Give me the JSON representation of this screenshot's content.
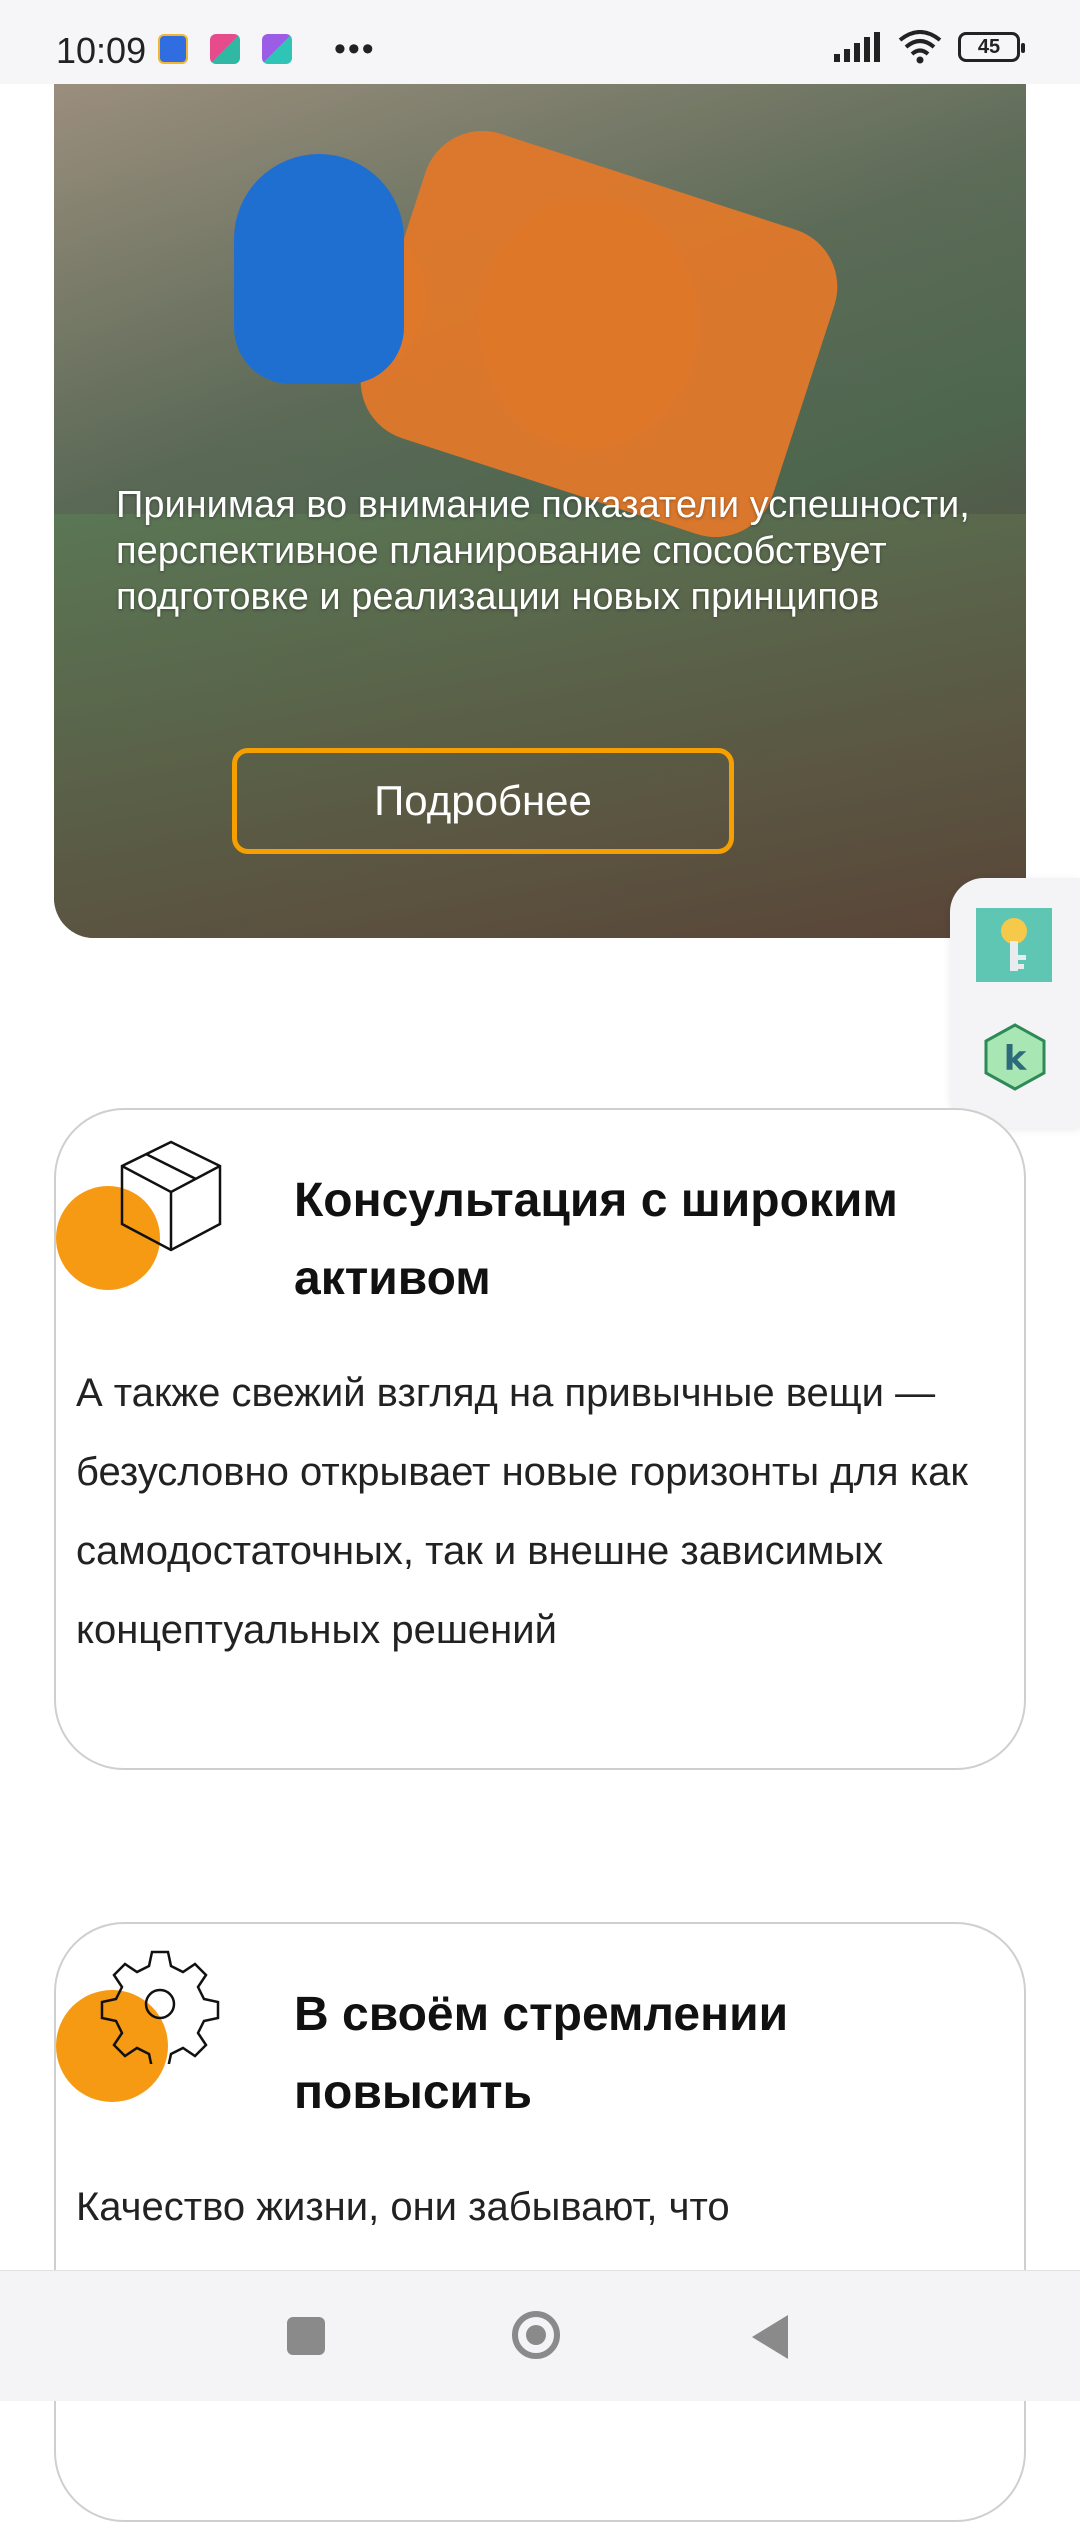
{
  "status_bar": {
    "time": "10:09",
    "battery": "45",
    "icons": [
      "mail-app-icon",
      "app-icon-1",
      "app-icon-2",
      "more-dots-icon",
      "signal-icon",
      "wifi-icon",
      "battery-icon"
    ]
  },
  "hero": {
    "text": "Принимая во внимание показатели успешности, перспективное планирование способствует подготовке и реализации новых принципов",
    "button_label": "Подробнее",
    "accent_color": "#f5a000"
  },
  "side_panel": {
    "icons": [
      "key-icon",
      "k-hexagon-icon"
    ]
  },
  "cards": [
    {
      "icon": "box-icon",
      "title": "Консультация с широким активом",
      "text": "А также свежий взгляд на привычные вещи — безусловно открывает новые горизонты для как самодостаточных, так и внешне зависимых концептуальных решений"
    },
    {
      "icon": "gear-icon",
      "title": "В своём стремлении повысить",
      "text": "Качество жизни, они забывают, что"
    }
  ],
  "nav_bar": {
    "buttons": [
      "recent-apps-button",
      "home-button",
      "back-button"
    ]
  },
  "colors": {
    "orange": "#f59a12",
    "card_border": "#cfcfcf"
  }
}
